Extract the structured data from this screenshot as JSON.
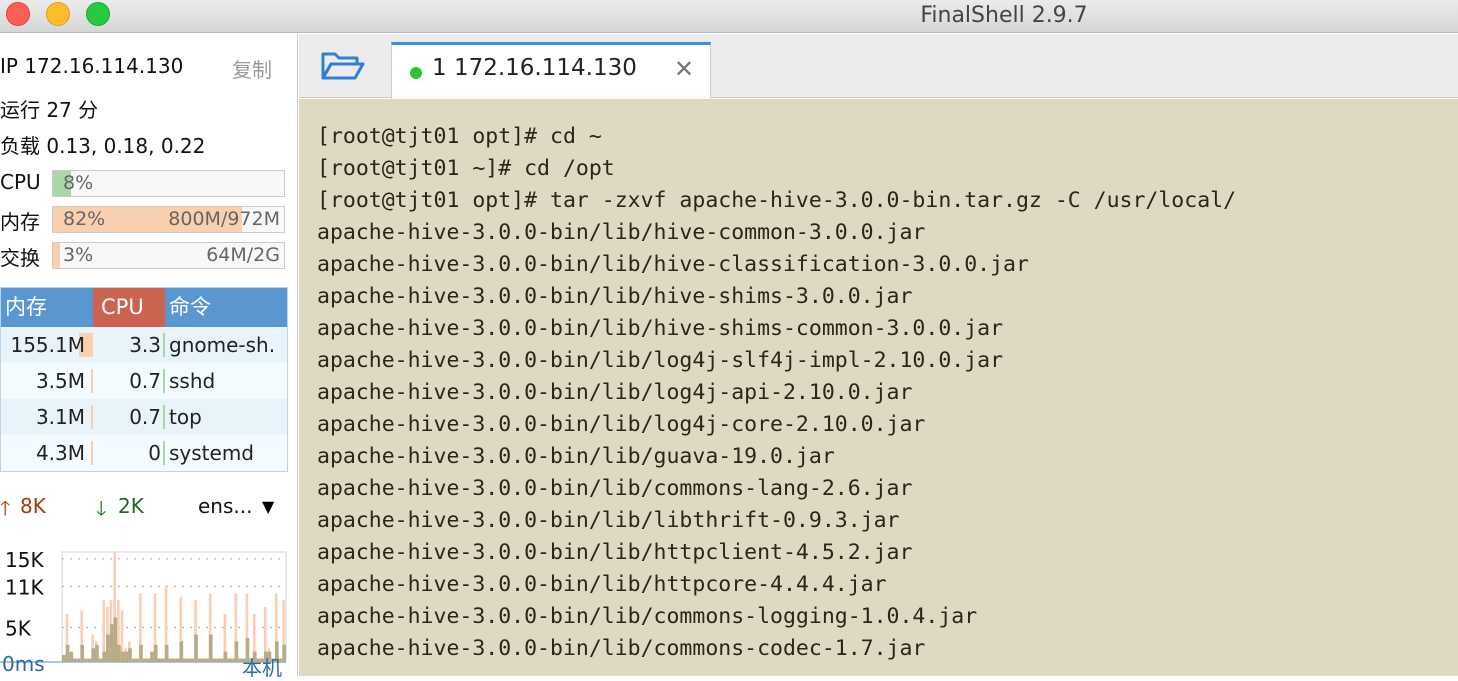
{
  "window": {
    "title": "FinalShell 2.9.7"
  },
  "sidebar": {
    "ip": "IP 172.16.114.130",
    "copy": "复制",
    "uptime": "运行 27 分",
    "load": "负载 0.13, 0.18, 0.22",
    "meters": [
      {
        "label": "CPU",
        "pct_text": "8%",
        "amount": "",
        "fraction": 0.08,
        "color": "#a8d8a8"
      },
      {
        "label": "内存",
        "pct_text": "82%",
        "amount": "800M/972M",
        "fraction": 0.82,
        "color": "#f9cfae"
      },
      {
        "label": "交换",
        "pct_text": "3%",
        "amount": "64M/2G",
        "fraction": 0.03,
        "color": "#f9cfae"
      }
    ],
    "process_table": {
      "headers": [
        "内存",
        "CPU",
        "命令"
      ],
      "header_colors": [
        "#5a96d0",
        "#cb6350",
        "#5a96d0"
      ],
      "rows": [
        {
          "mem": "155.1M",
          "cpu": "3.3",
          "cmd": "gnome-sh.",
          "mem_bar": 1.0
        },
        {
          "mem": "3.5M",
          "cpu": "0.7",
          "cmd": "sshd",
          "mem_bar": 0.02
        },
        {
          "mem": "3.1M",
          "cpu": "0.7",
          "cmd": "top",
          "mem_bar": 0.02
        },
        {
          "mem": "4.3M",
          "cpu": "0",
          "cmd": "systemd",
          "mem_bar": 0.02
        }
      ]
    },
    "network": {
      "up": "8K",
      "down": "2K",
      "interface": "ens...",
      "latency": "0ms",
      "host": "本机",
      "up_color": "#a33a10",
      "down_color": "#1e6b1e"
    }
  },
  "chart_data": {
    "type": "bar",
    "ylim": [
      0,
      16
    ],
    "tick_labels": [
      "15K",
      "11K",
      "5K"
    ],
    "ticks": [
      15,
      11,
      5
    ],
    "series": [
      {
        "values": [
          1,
          7,
          1,
          0.5,
          0.5,
          7.5,
          0.5,
          0.5,
          4,
          3,
          0.5,
          9,
          8,
          9,
          16,
          9,
          7.5,
          2,
          3,
          0.5,
          0.5,
          10,
          0.5,
          0.5,
          0.5,
          10,
          0.5,
          0.5,
          11,
          0.5,
          0.5,
          0.5,
          9.5,
          0.5,
          0.5,
          0.5,
          9,
          0.5,
          0.5,
          0.5,
          10,
          0.5,
          0.5,
          0.5,
          7,
          0.5,
          0.5,
          10,
          0.5,
          0.5,
          10,
          0.5,
          7,
          0.5,
          0.5,
          8,
          2,
          0.5,
          10,
          0.5,
          9
        ],
        "color": "#fbcdb4"
      },
      {
        "values": [
          1,
          2.5,
          1.5,
          0.5,
          0.5,
          2.5,
          0.5,
          0.5,
          2,
          2.5,
          0.5,
          1.5,
          4,
          5.5,
          6.5,
          2.5,
          1.5,
          1.5,
          2,
          0.5,
          0.5,
          2.5,
          0.5,
          0.5,
          1.5,
          2.5,
          0.5,
          0.5,
          2.5,
          0.5,
          0.5,
          0.5,
          3,
          0.5,
          0.5,
          0.5,
          4,
          0.5,
          0.5,
          0.5,
          4,
          0.5,
          0.5,
          0.5,
          1.5,
          0.5,
          0.5,
          3,
          0.5,
          0.5,
          3.5,
          0.5,
          1.5,
          0.5,
          0.5,
          1.5,
          1.5,
          0.5,
          3,
          0.5,
          2.5
        ],
        "color": "#b8ab87"
      }
    ]
  },
  "tabs": [
    {
      "label": "1 172.16.114.130",
      "status_color": "#2cc431"
    }
  ],
  "terminal": {
    "lines": [
      "[root@tjt01 opt]# cd ~",
      "[root@tjt01 ~]# cd /opt",
      "[root@tjt01 opt]# tar -zxvf apache-hive-3.0.0-bin.tar.gz -C /usr/local/",
      "apache-hive-3.0.0-bin/lib/hive-common-3.0.0.jar",
      "apache-hive-3.0.0-bin/lib/hive-classification-3.0.0.jar",
      "apache-hive-3.0.0-bin/lib/hive-shims-3.0.0.jar",
      "apache-hive-3.0.0-bin/lib/hive-shims-common-3.0.0.jar",
      "apache-hive-3.0.0-bin/lib/log4j-slf4j-impl-2.10.0.jar",
      "apache-hive-3.0.0-bin/lib/log4j-api-2.10.0.jar",
      "apache-hive-3.0.0-bin/lib/log4j-core-2.10.0.jar",
      "apache-hive-3.0.0-bin/lib/guava-19.0.jar",
      "apache-hive-3.0.0-bin/lib/commons-lang-2.6.jar",
      "apache-hive-3.0.0-bin/lib/libthrift-0.9.3.jar",
      "apache-hive-3.0.0-bin/lib/httpclient-4.5.2.jar",
      "apache-hive-3.0.0-bin/lib/httpcore-4.4.4.jar",
      "apache-hive-3.0.0-bin/lib/commons-logging-1.0.4.jar",
      "apache-hive-3.0.0-bin/lib/commons-codec-1.7.jar"
    ]
  }
}
